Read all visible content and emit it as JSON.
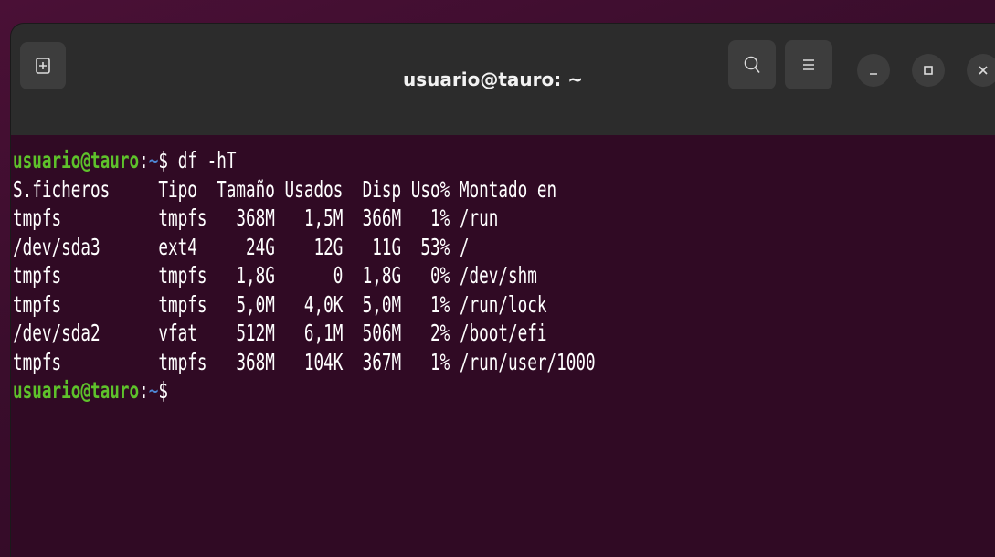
{
  "window": {
    "title": "usuario@tauro: ~"
  },
  "headerbar": {
    "new_tab_icon": "new-tab-icon",
    "search_icon": "search-icon",
    "menu_icon": "hamburger-menu-icon",
    "minimize_icon": "minimize-icon",
    "maximize_icon": "maximize-icon",
    "close_icon": "close-icon",
    "minimize_glyph": "_",
    "maximize_glyph": "□",
    "close_glyph": "X"
  },
  "terminal": {
    "prompt1": {
      "user_host": "usuario@tauro",
      "separator": ":",
      "path": "~",
      "symbol": "$",
      "command": " df -hT"
    },
    "output_lines": [
      "S.ficheros     Tipo  Tamaño Usados  Disp Uso% Montado en",
      "tmpfs          tmpfs   368M   1,5M  366M   1% /run",
      "/dev/sda3      ext4     24G    12G   11G  53% /",
      "tmpfs          tmpfs   1,8G      0  1,8G   0% /dev/shm",
      "tmpfs          tmpfs   5,0M   4,0K  5,0M   1% /run/lock",
      "/dev/sda2      vfat    512M   6,1M  506M   2% /boot/efi",
      "tmpfs          tmpfs   368M   104K  367M   1% /run/user/1000"
    ],
    "prompt2": {
      "user_host": "usuario@tauro",
      "separator": ":",
      "path": "~",
      "symbol": "$"
    }
  }
}
